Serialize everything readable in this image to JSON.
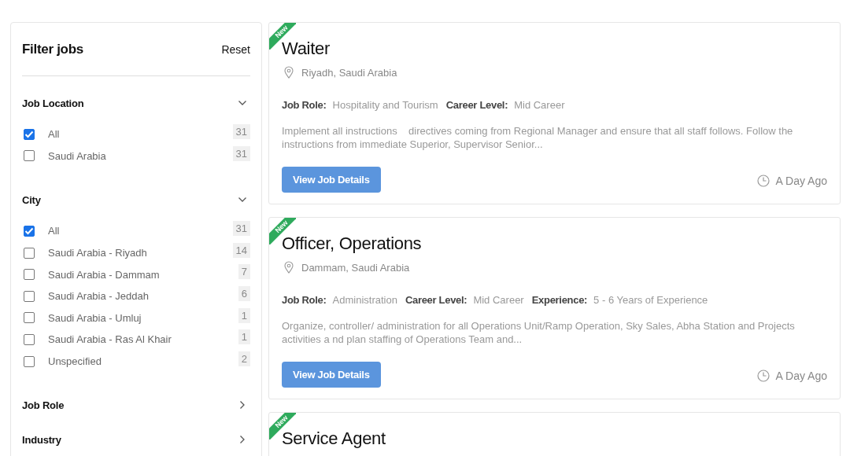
{
  "filter": {
    "title": "Filter jobs",
    "reset": "Reset",
    "sections": [
      {
        "title": "Job Location",
        "expanded": true,
        "options": [
          {
            "label": "All",
            "checked": true,
            "count": "31"
          },
          {
            "label": "Saudi Arabia",
            "checked": false,
            "count": "31"
          }
        ]
      },
      {
        "title": "City",
        "expanded": true,
        "options": [
          {
            "label": "All",
            "checked": true,
            "count": "31"
          },
          {
            "label": "Saudi Arabia - Riyadh",
            "checked": false,
            "count": "14"
          },
          {
            "label": "Saudi Arabia - Dammam",
            "checked": false,
            "count": "7"
          },
          {
            "label": "Saudi Arabia - Jeddah",
            "checked": false,
            "count": "6"
          },
          {
            "label": "Saudi Arabia - Umluj",
            "checked": false,
            "count": "1"
          },
          {
            "label": "Saudi Arabia - Ras Al Khair",
            "checked": false,
            "count": "1"
          },
          {
            "label": "Unspecified",
            "checked": false,
            "count": "2"
          }
        ]
      },
      {
        "title": "Job Role",
        "expanded": false
      },
      {
        "title": "Industry",
        "expanded": false
      }
    ]
  },
  "jobs": [
    {
      "badge": "New",
      "title": "Waiter",
      "location": "Riyadh, Saudi Arabia",
      "meta": [
        {
          "label": "Job Role:",
          "value": "Hospitality and Tourism"
        },
        {
          "label": "Career Level:",
          "value": "Mid Career"
        }
      ],
      "description": "Implement all instructions    directives coming from Regional Manager and ensure that all staff follows. Follow the instructions from immediate Superior, Supervisor Senior...",
      "button": "View Job Details",
      "posted": "A Day Ago"
    },
    {
      "badge": "New",
      "title": "Officer, Operations",
      "location": "Dammam, Saudi Arabia",
      "meta": [
        {
          "label": "Job Role:",
          "value": "Administration"
        },
        {
          "label": "Career Level:",
          "value": "Mid Career"
        },
        {
          "label": "Experience:",
          "value": "5 - 6 Years of Experience"
        }
      ],
      "description": "Organize, controller/ administration for all Operations Unit/Ramp Operation, Sky Sales, Abha Station and Projects activities a nd plan staffing of Operations Team and...",
      "button": "View Job Details",
      "posted": "A Day Ago"
    },
    {
      "badge": "New",
      "title": "Service Agent"
    }
  ]
}
